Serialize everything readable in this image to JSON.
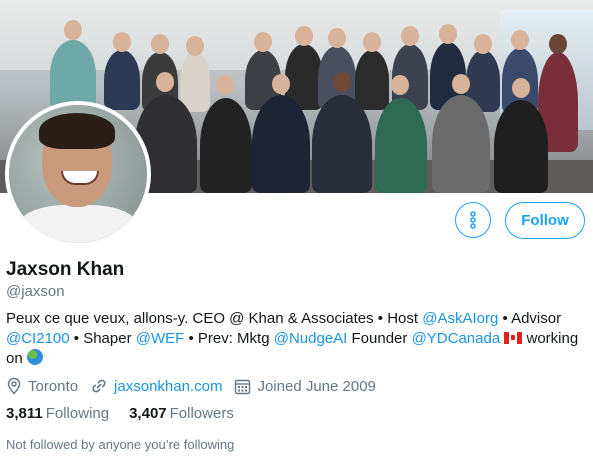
{
  "profile": {
    "name": "Jaxson Khan",
    "handle": "@jaxson",
    "bio": {
      "p1": "Peux ce que veux, allons-y. CEO @ Khan & Associates • Host ",
      "mention_askai": "@AskAIorg",
      "p2": "  • Advisor ",
      "mention_ci2100": "@CI2100",
      "p3": " • Shaper ",
      "mention_wef": "@WEF",
      "p4": " • Prev: Mktg ",
      "mention_nudgeai": "@NudgeAI",
      "p5": "  Founder ",
      "mention_ydcanada": "@YDCanada",
      "p6": " working on "
    },
    "location": "Toronto",
    "website": "jaxsonkhan.com",
    "joined": "Joined June 2009",
    "following_count": "3,811",
    "following_label": "Following",
    "followers_count": "3,407",
    "followers_label": "Followers",
    "followed_by_note": "Not followed by anyone you’re following"
  },
  "actions": {
    "follow_label": "Follow",
    "more_icon": "more-vertical-icon"
  },
  "colors": {
    "accent": "#1da1f2",
    "link": "#1b95e0",
    "secondary_text": "#657786",
    "primary_text": "#14171a"
  },
  "icons": {
    "location": "location-pin-icon",
    "website": "link-icon",
    "joined": "calendar-icon",
    "flag": "canada-flag-emoji",
    "globe": "globe-emoji"
  }
}
